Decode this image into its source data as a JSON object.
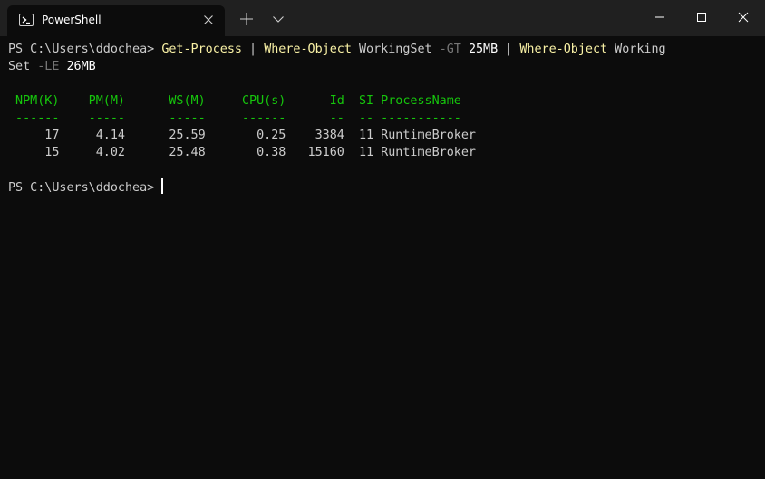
{
  "window": {
    "tab": {
      "title": "PowerShell",
      "icon": "powershell-icon",
      "close_icon": "close-icon"
    },
    "new_tab_icon": "plus-icon",
    "dropdown_icon": "chevron-down-icon",
    "controls": [
      "minimize-icon",
      "maximize-icon",
      "close-icon"
    ]
  },
  "colors": {
    "titlebar": "#202020",
    "terminal_bg": "#0c0c0c",
    "command": "#f9f1a5",
    "parameter": "#767676",
    "header": "#16c60c",
    "text": "#cccccc"
  },
  "terminal": {
    "command_line": {
      "prompt": "PS C:\\Users\\ddochea> ",
      "cmd1": "Get-Process",
      "pipe1": " | ",
      "cmd2": "Where-Object",
      "arg1": " WorkingSet ",
      "param1": "-GT",
      "space1": " ",
      "value1": "25MB",
      "pipe2": " | ",
      "cmd3": "Where-Object",
      "arg2": " Working",
      "arg2_wrap": "Set ",
      "param2": "-LE",
      "space2": " ",
      "value2": "26MB"
    },
    "table": {
      "header": " NPM(K)    PM(M)      WS(M)     CPU(s)      Id  SI ProcessName",
      "separator": " ------    -----      -----     ------      --  -- -----------",
      "rows": [
        "     17     4.14      25.59       0.25    3384  11 RuntimeBroker",
        "     15     4.02      25.48       0.38   15160  11 RuntimeBroker"
      ]
    },
    "final_prompt": "PS C:\\Users\\ddochea> "
  }
}
